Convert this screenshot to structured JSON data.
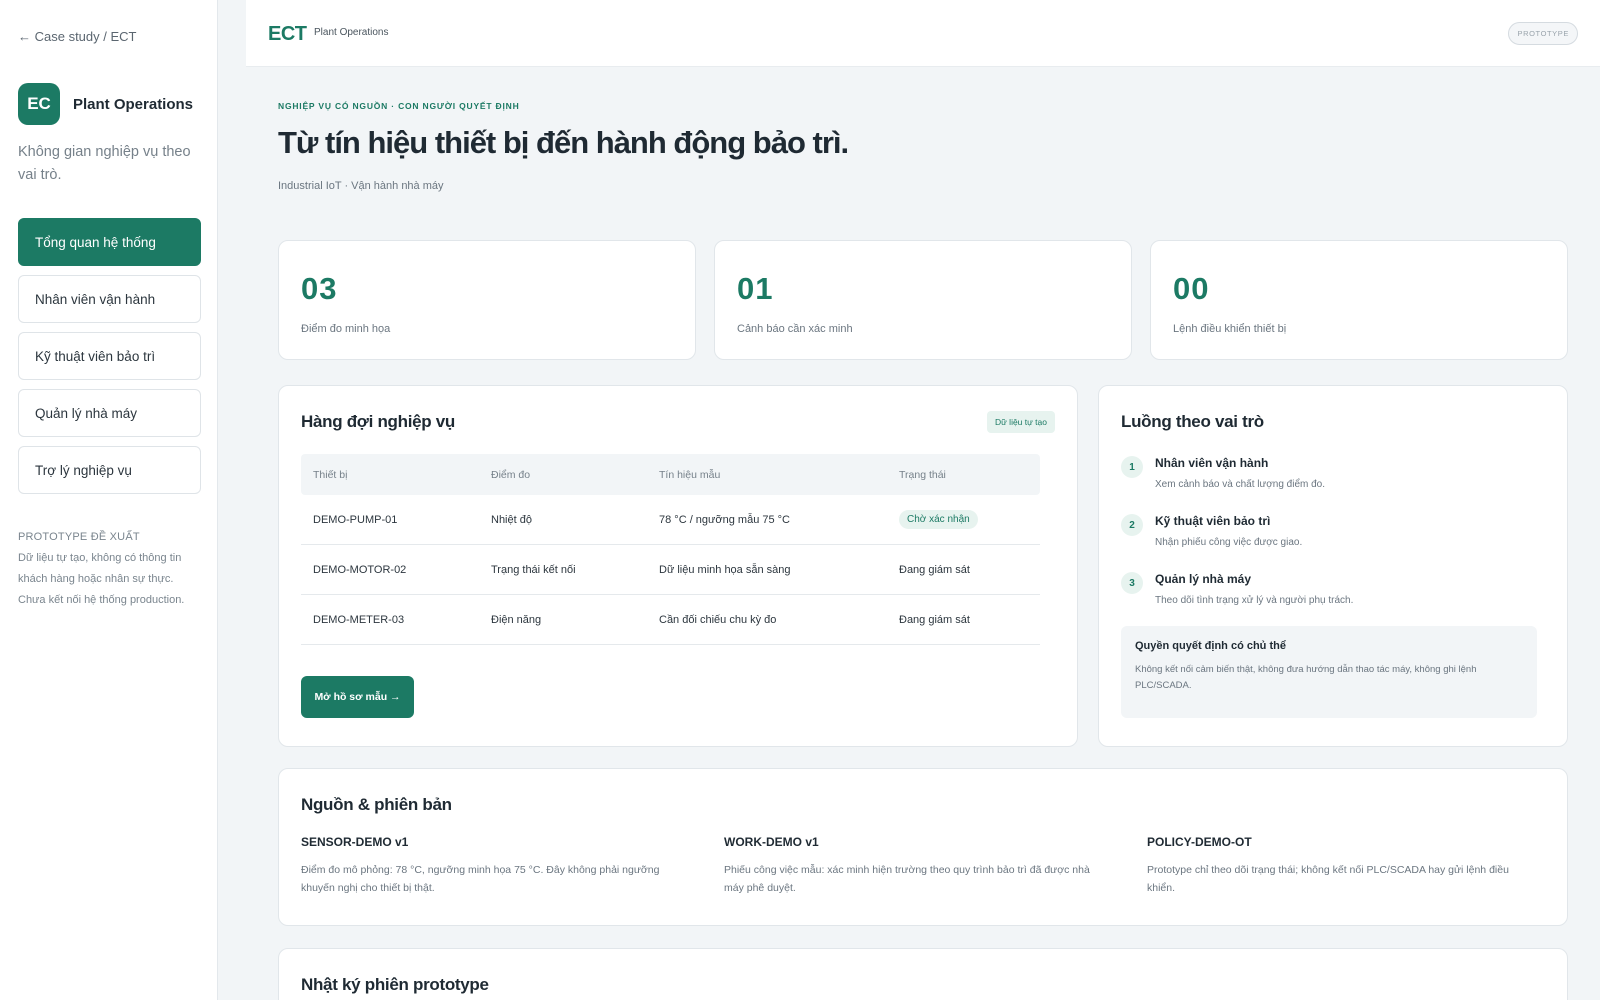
{
  "sidebar": {
    "back_link": "← Case study / ECT",
    "logo_text": "EC",
    "brand_name": "Plant Operations",
    "description": "Không gian nghiệp vụ theo vai trò.",
    "nav": [
      {
        "label": "Tổng quan hệ thống",
        "active": true
      },
      {
        "label": "Nhân viên vận hành",
        "active": false
      },
      {
        "label": "Kỹ thuật viên bảo trì",
        "active": false
      },
      {
        "label": "Quản lý nhà máy",
        "active": false
      },
      {
        "label": "Trợ lý nghiệp vụ",
        "active": false
      }
    ],
    "note_title": "PROTOTYPE ĐỀ XUẤT",
    "note_text": "Dữ liệu tự tạo, không có thông tin khách hàng hoặc nhân sự thực. Chưa kết nối hệ thống production."
  },
  "topbar": {
    "logo": "ECT",
    "subtitle": "Plant Operations",
    "badge": "PROTOTYPE"
  },
  "hero": {
    "eyebrow": "NGHIỆP VỤ CÓ NGUỒN · CON NGƯỜI QUYẾT ĐỊNH",
    "title": "Từ tín hiệu thiết bị đến hành động bảo trì.",
    "subtitle": "Industrial IoT · Vận hành nhà máy"
  },
  "stats": [
    {
      "value": "03",
      "label": "Điểm đo minh họa"
    },
    {
      "value": "01",
      "label": "Cảnh báo cần xác minh"
    },
    {
      "value": "00",
      "label": "Lệnh điều khiển thiết bị"
    }
  ],
  "queue": {
    "title": "Hàng đợi nghiệp vụ",
    "badge": "Dữ liệu tự tạo",
    "columns": [
      "Thiết bị",
      "Điểm đo",
      "Tín hiệu mẫu",
      "Trạng thái"
    ],
    "rows": [
      {
        "device": "DEMO-PUMP-01",
        "point": "Nhiệt độ",
        "signal": "78 °C / ngưỡng mẫu 75 °C",
        "status": "Chờ xác nhận"
      },
      {
        "device": "DEMO-MOTOR-02",
        "point": "Trạng thái kết nối",
        "signal": "Dữ liệu minh họa sẵn sàng",
        "status": "Đang giám sát"
      },
      {
        "device": "DEMO-METER-03",
        "point": "Điện năng",
        "signal": "Cần đối chiếu chu kỳ đo",
        "status": "Đang giám sát"
      }
    ],
    "button": "Mở hồ sơ mẫu →"
  },
  "flow": {
    "title": "Luồng theo vai trò",
    "steps": [
      {
        "num": "1",
        "title": "Nhân viên vận hành",
        "desc": "Xem cảnh báo và chất lượng điểm đo."
      },
      {
        "num": "2",
        "title": "Kỹ thuật viên bảo trì",
        "desc": "Nhận phiếu công việc được giao."
      },
      {
        "num": "3",
        "title": "Quản lý nhà máy",
        "desc": "Theo dõi tình trạng xử lý và người phụ trách."
      }
    ],
    "decision_title": "Quyền quyết định có chủ thể",
    "decision_text": "Không kết nối cảm biến thật, không đưa hướng dẫn thao tác máy, không ghi lệnh PLC/SCADA."
  },
  "sources": {
    "title": "Nguồn & phiên bản",
    "items": [
      {
        "title": "SENSOR-DEMO v1",
        "text": "Điểm đo mô phỏng: 78 °C, ngưỡng minh họa 75 °C. Đây không phải ngưỡng khuyến nghị cho thiết bị thật."
      },
      {
        "title": "WORK-DEMO v1",
        "text": "Phiếu công việc mẫu: xác minh hiện trường theo quy trình bảo trì đã được nhà máy phê duyệt."
      },
      {
        "title": "POLICY-DEMO-OT",
        "text": "Prototype chỉ theo dõi trạng thái; không kết nối PLC/SCADA hay gửi lệnh điều khiển."
      }
    ]
  },
  "log": {
    "title": "Nhật ký phiên prototype"
  }
}
